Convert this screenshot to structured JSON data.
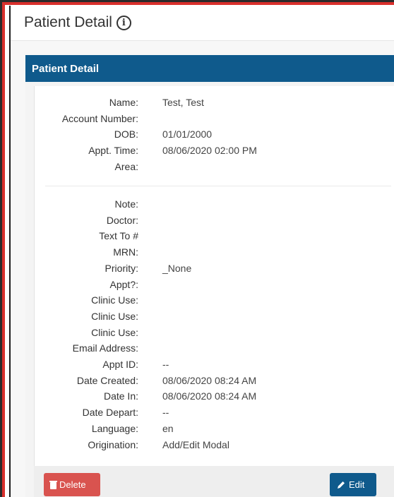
{
  "header": {
    "title": "Patient Detail"
  },
  "panel": {
    "heading": "Patient Detail"
  },
  "section1": [
    {
      "label": "Name:",
      "value": "Test, Test"
    },
    {
      "label": "Account Number:",
      "value": ""
    },
    {
      "label": "DOB:",
      "value": "01/01/2000"
    },
    {
      "label": "Appt. Time:",
      "value": "08/06/2020 02:00 PM"
    },
    {
      "label": "Area:",
      "value": ""
    }
  ],
  "section2": [
    {
      "label": "Note:",
      "value": ""
    },
    {
      "label": "Doctor:",
      "value": ""
    },
    {
      "label": "Text To #",
      "value": ""
    },
    {
      "label": "MRN:",
      "value": ""
    },
    {
      "label": "Priority:",
      "value": "_None"
    },
    {
      "label": "Appt?:",
      "value": ""
    },
    {
      "label": "Clinic Use:",
      "value": ""
    },
    {
      "label": "Clinic Use:",
      "value": ""
    },
    {
      "label": "Clinic Use:",
      "value": ""
    },
    {
      "label": "Email Address:",
      "value": ""
    },
    {
      "label": "Appt ID:",
      "value": "--"
    },
    {
      "label": "Date Created:",
      "value": "08/06/2020 08:24 AM"
    },
    {
      "label": "Date In:",
      "value": "08/06/2020 08:24 AM"
    },
    {
      "label": "Date Depart:",
      "value": "--"
    },
    {
      "label": "Language:",
      "value": "en"
    },
    {
      "label": "Origination:",
      "value": "Add/Edit Modal"
    }
  ],
  "buttons": {
    "delete": "Delete",
    "edit": "Edit"
  },
  "colors": {
    "heading_bg": "#0f5a8c",
    "delete_bg": "#d9534f",
    "edit_bg": "#0f5a8c",
    "frame_red": "#d9302c"
  },
  "icons": {
    "title_info": "info-icon",
    "delete": "trash-icon",
    "edit": "pencil-icon"
  }
}
